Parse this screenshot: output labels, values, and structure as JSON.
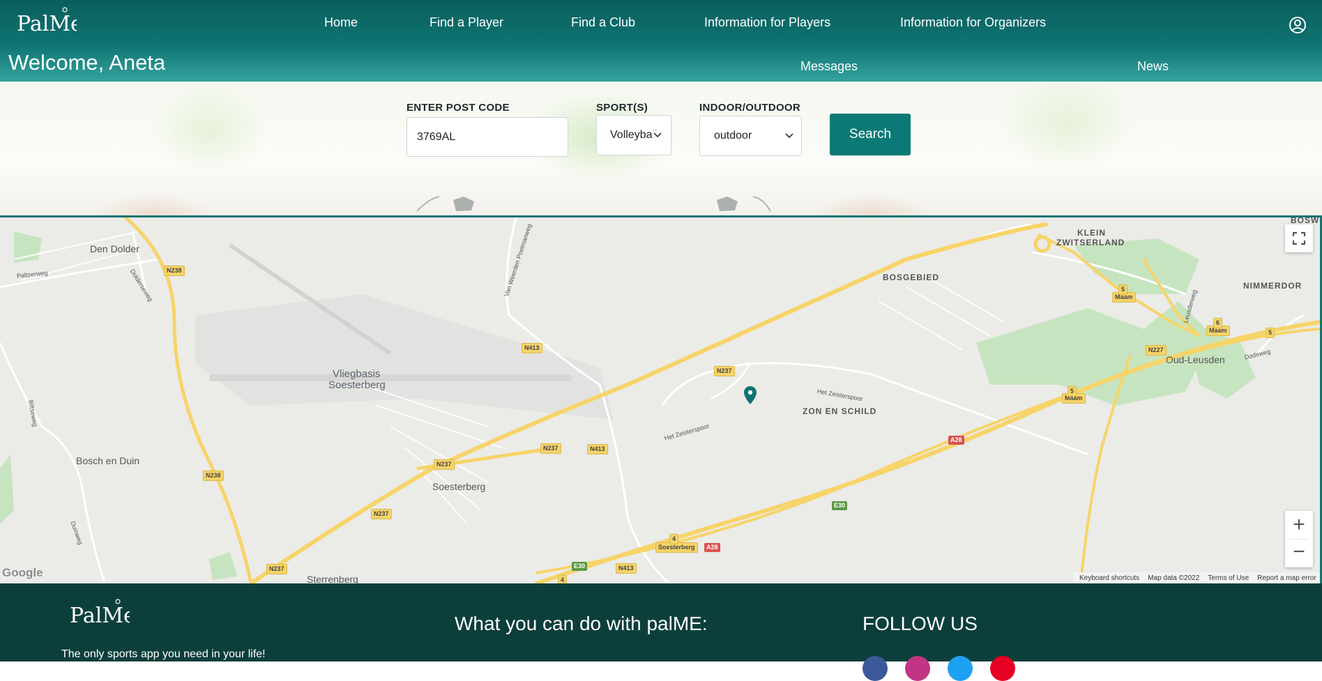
{
  "header": {
    "logo_text": "PalMe",
    "nav": [
      "Home",
      "Find a Player",
      "Find a Club",
      "Information for Players",
      "Information for Organizers"
    ],
    "welcome": "Welcome, Aneta",
    "sub_nav": [
      "Messages",
      "News"
    ],
    "user_icon": "user-circle-icon"
  },
  "search": {
    "postcode_label": "ENTER POST CODE",
    "postcode_value": "3769AL",
    "sport_label": "SPORT(S)",
    "sport_value": "Volleyball",
    "inout_label": "INDOOR/OUTDOOR",
    "inout_value": "outdoor",
    "search_button": "Search"
  },
  "map": {
    "places": {
      "den_dolder": "Den Dolder",
      "vliegbasis_1": "Vliegbasis",
      "vliegbasis_2": "Soesterberg",
      "bosch_en_duin": "Bosch en Duin",
      "soesterberg": "Soesterberg",
      "sterrenberg": "Sterrenberg",
      "bosgebied": "BOSGEBIED",
      "klein": "KLEIN",
      "zwitserland": "ZWITSERLAND",
      "nimmerdor": "NIMMERDOR",
      "oud_leusden": "Oud-Leusden",
      "zon_en_schild": "ZON EN SCHILD",
      "bosw": "BOSW"
    },
    "streets": {
      "paltzerweg": "Paltzerweg",
      "dolderseweg": "Dolderseweg",
      "van_weerden": "Van Weerden Poelmanweg",
      "bilitseweg": "Biltseweg",
      "duinweg": "Duinweg",
      "het_zeisterspoor_1": "Het Zeisterspoor",
      "het_zeisterspoor_2": "Het Zeisterspoor",
      "leusderweg": "Leusderweg",
      "dodeweg": "Dodeweg"
    },
    "shields": {
      "n238_a": "N238",
      "n238_b": "N238",
      "n413_a": "N413",
      "n413_b": "N413",
      "n413_c": "N413",
      "n237_a": "N237",
      "n237_b": "N237",
      "n237_c": "N237",
      "n237_d": "N237",
      "n237_e": "N237",
      "a28_a": "A28",
      "a28_b": "A28",
      "e30_a": "E30",
      "e30_b": "E30",
      "n227": "N227",
      "maam_a": "Maam",
      "maam_b": "Maam",
      "maam_c": "Maam",
      "soesterberg_exit": "Soesterberg",
      "num4_a": "4",
      "num4_b": "4",
      "num5_a": "5",
      "num5_b": "5",
      "num5_c": "5",
      "num6": "6"
    },
    "attribution": {
      "google": "Google",
      "shortcuts": "Keyboard shortcuts",
      "map_data": "Map data ©2022",
      "terms": "Terms of Use",
      "report": "Report a map error"
    },
    "zoom_in": "+",
    "zoom_out": "−"
  },
  "footer": {
    "logo_text": "PalMe",
    "tagline": "The only sports app you need in your life!",
    "what_title": "What you can do with palME:",
    "follow_title": "FOLLOW US"
  },
  "colors": {
    "header_dark": "#0a5e5c",
    "accent": "#0b7a76",
    "footer": "#0c3f3b",
    "road_yellow": "#f7d469",
    "map_bg": "#ebebe8",
    "park_green": "#c7e4c0"
  }
}
